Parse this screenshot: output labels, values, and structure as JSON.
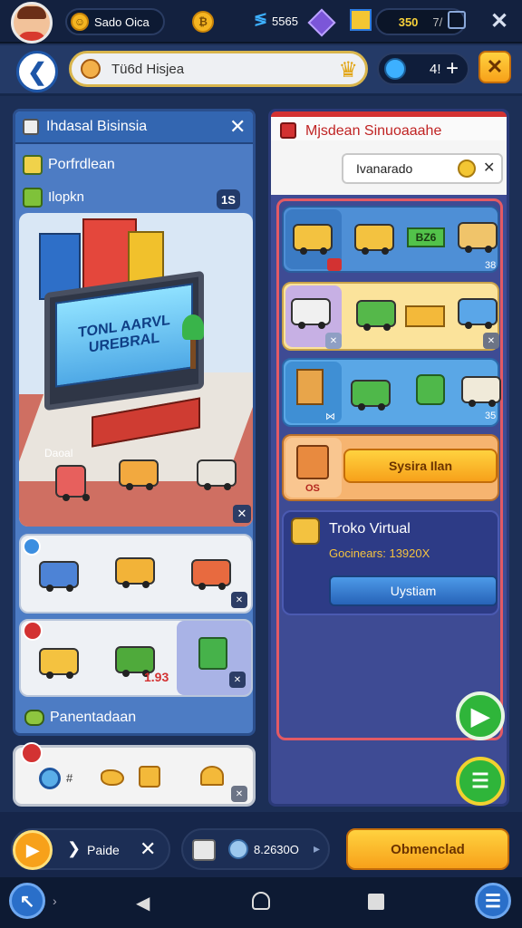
{
  "header": {
    "player_name": "Sado Oica",
    "currency1": "5565",
    "currency2": "350",
    "currency2_suffix": "7/"
  },
  "nav": {
    "search_text": "Tü6d Hisjea",
    "level_value": "4!",
    "level_plus": "+"
  },
  "left_panel": {
    "title": "Ihdasal Bisinsia",
    "section1": "Porfrdlean",
    "section2": "Ilopkn",
    "badge": "1S",
    "billboard_text": "TONL AARVL UREBRAL",
    "ground_label": "Daoal",
    "price_tag": "1.93",
    "footer": "Panentadaan"
  },
  "right_panel": {
    "title": "Mjsdean Sinuoaaahe",
    "search_value": "Ivanarado",
    "row1_tag": "BZ6",
    "row1_count": "38",
    "row3_count": "35",
    "row4_btn": "Sysira Ilan",
    "row4_count": "OS",
    "store_title": "Troko Virtual",
    "store_sub": "Gocinears: 13920X",
    "store_btn": "Uystiam"
  },
  "bottom": {
    "play_label": "Paide",
    "coins_value": "8.2630O",
    "action_btn": "Obmenclad"
  },
  "colors": {
    "accent": "#f7a11a",
    "panel_blue": "#4d7cc4",
    "panel_purple": "#3e4b94",
    "green": "#2fb53a"
  }
}
